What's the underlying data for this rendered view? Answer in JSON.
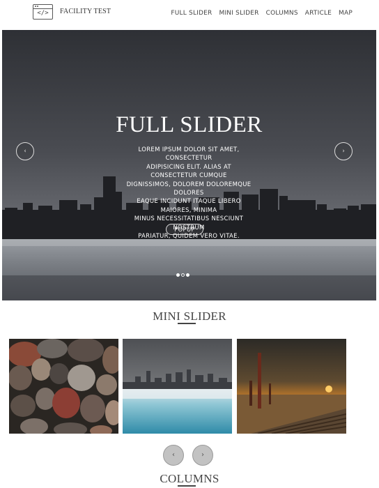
{
  "header": {
    "logo_icon": "code-window-icon",
    "logo_code": "</>",
    "title": "FACILITY TEST",
    "nav": [
      "FULL SLIDER",
      "MINI SLIDER",
      "COLUMNS",
      "ARTICLE",
      "MAP"
    ]
  },
  "hero": {
    "title": "FULL SLIDER",
    "text_lines": [
      "LOREM IPSUM DOLOR SIT AMET,",
      "CONSECTETUR",
      "ADIPISICING ELIT. ALIAS AT",
      "CONSECTETUR CUMQUE",
      "DIGNISSIMOS, DOLOREM DOLOREMQUE",
      "DOLORES",
      "EAQUE INCIDUNT ITAQUE LIBERO",
      "MAIORES, MINIMA",
      "MINUS NECESSITATIBUS NESCIUNT",
      "NOSTRUM",
      "PARIATUR, QUIDEM VERO VITAE."
    ],
    "button_label": "POPUP",
    "prev_icon": "‹",
    "next_icon": "›",
    "slides_count": 3,
    "active_slide": 2
  },
  "mini_slider": {
    "heading": "MINI SLIDER",
    "images": [
      "pebbles-image",
      "city-skyline-image",
      "sunset-boardwalk-image"
    ],
    "prev_icon": "‹",
    "next_icon": "›"
  },
  "columns": {
    "heading": "COLUMNS"
  }
}
